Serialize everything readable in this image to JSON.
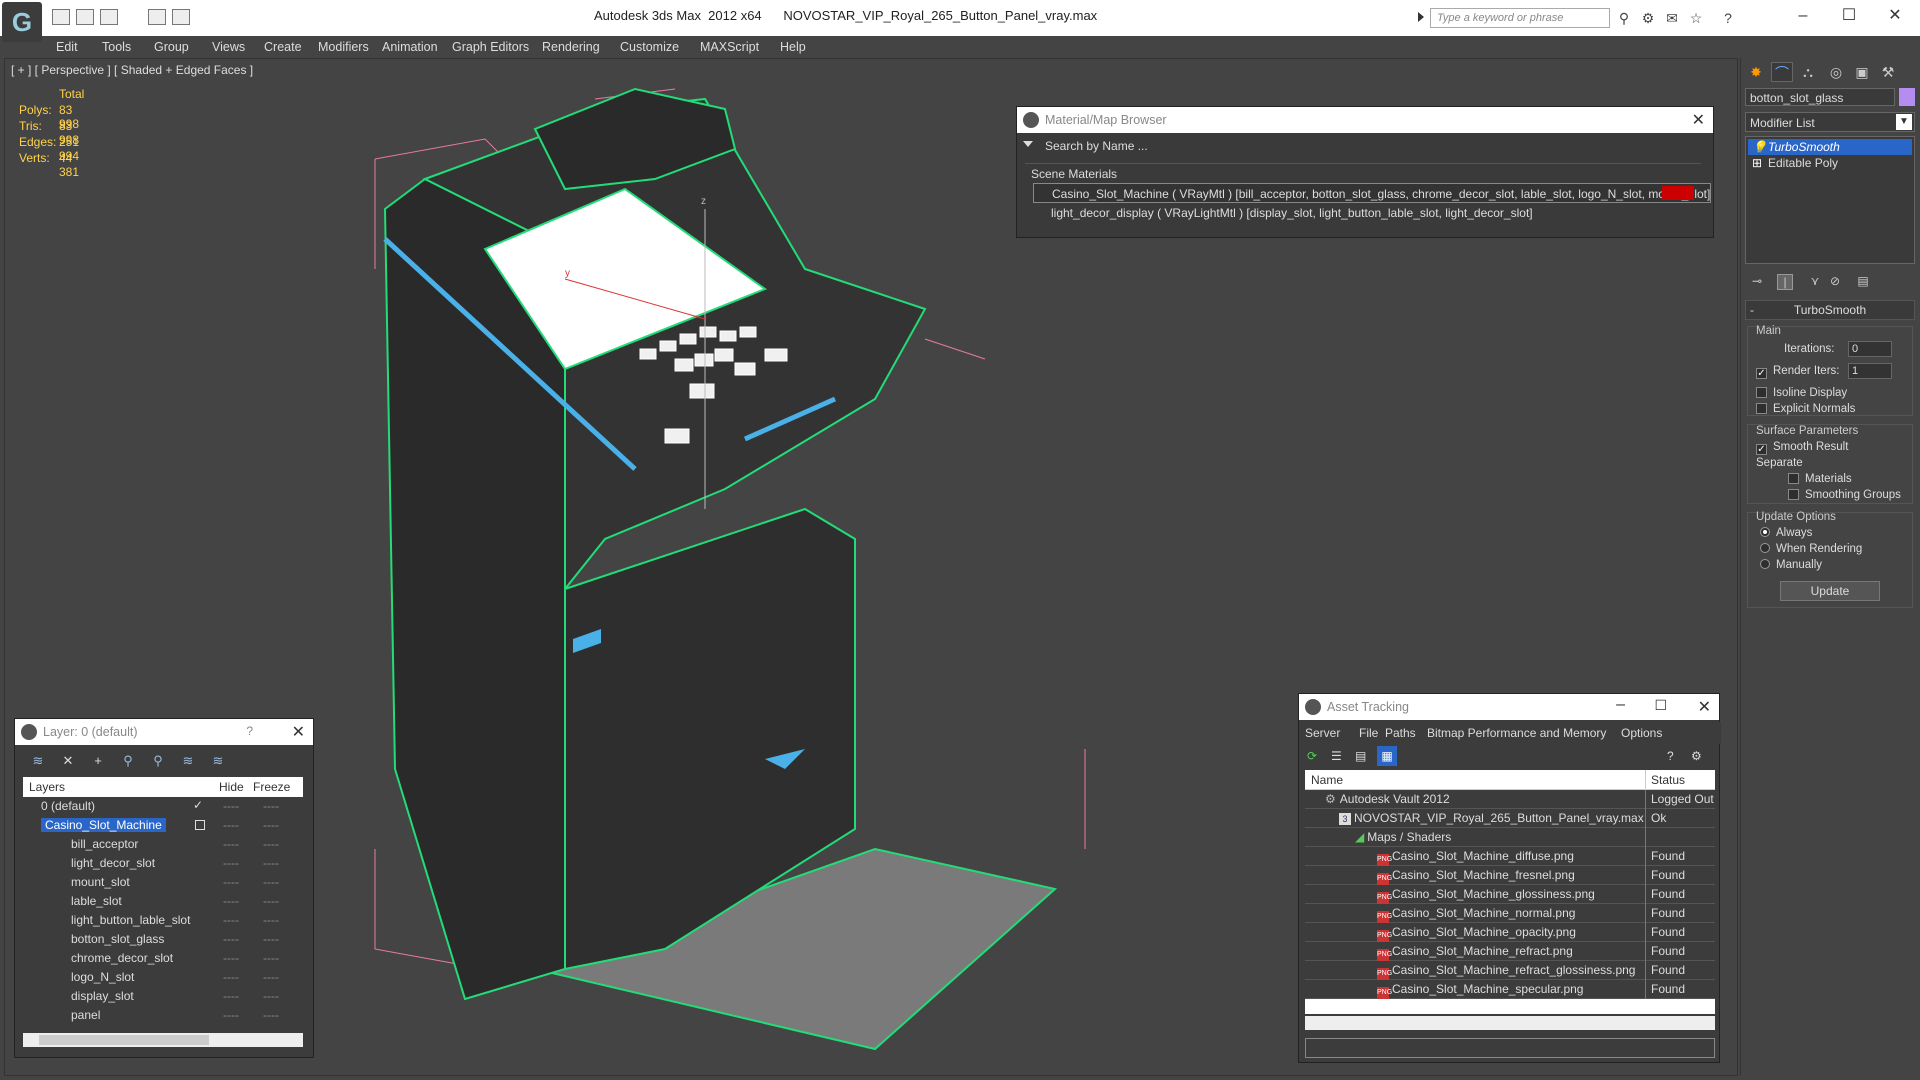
{
  "titlebar": {
    "title": "Autodesk 3ds Max  2012 x64      NOVOSTAR_VIP_Royal_265_Button_Panel_vray.max",
    "search_placeholder": "Type a keyword or phrase"
  },
  "menu": [
    "Edit",
    "Tools",
    "Group",
    "Views",
    "Create",
    "Modifiers",
    "Animation",
    "Graph Editors",
    "Rendering",
    "Customize",
    "MAXScript",
    "Help"
  ],
  "viewport": {
    "label": "[ + ] [ Perspective ] [ Shaded + Edged Faces ]",
    "stats": {
      "heading": "Total",
      "rows": [
        {
          "label": "Polys:",
          "value": "83 998"
        },
        {
          "label": "Tris:",
          "value": "83 998"
        },
        {
          "label": "Edges:",
          "value": "251 994"
        },
        {
          "label": "Verts:",
          "value": "44 381"
        }
      ]
    },
    "gizmo_labels": {
      "y": "y",
      "z": "z"
    }
  },
  "material_browser": {
    "title": "Material/Map Browser",
    "search_placeholder": "Search by Name ...",
    "section": "Scene Materials",
    "rows": [
      "Casino_Slot_Machine ( VRayMtl ) [bill_acceptor, botton_slot_glass, chrome_decor_slot, lable_slot, logo_N_slot, mount_slot]",
      "light_decor_display ( VRayLightMtl ) [display_slot, light_button_lable_slot, light_decor_slot]"
    ],
    "swatch_color": "#cc0000"
  },
  "layer_panel": {
    "title": "Layer: 0 (default)",
    "help": "?",
    "columns": {
      "layers": "Layers",
      "hide": "Hide",
      "freeze": "Freeze"
    },
    "rows": [
      {
        "name": "0 (default)",
        "hide": "----",
        "freeze": "----"
      },
      {
        "name": "Casino_Slot_Machine",
        "hide": "----",
        "freeze": "----"
      },
      {
        "name": "bill_acceptor",
        "hide": "----",
        "freeze": "----"
      },
      {
        "name": "light_decor_slot",
        "hide": "----",
        "freeze": "----"
      },
      {
        "name": "mount_slot",
        "hide": "----",
        "freeze": "----"
      },
      {
        "name": "lable_slot",
        "hide": "----",
        "freeze": "----"
      },
      {
        "name": "light_button_lable_slot",
        "hide": "----",
        "freeze": "----"
      },
      {
        "name": "botton_slot_glass",
        "hide": "----",
        "freeze": "----"
      },
      {
        "name": "chrome_decor_slot",
        "hide": "----",
        "freeze": "----"
      },
      {
        "name": "logo_N_slot",
        "hide": "----",
        "freeze": "----"
      },
      {
        "name": "display_slot",
        "hide": "----",
        "freeze": "----"
      },
      {
        "name": "panel",
        "hide": "----",
        "freeze": "----"
      }
    ]
  },
  "asset_tracking": {
    "title": "Asset Tracking",
    "menu": [
      "Server",
      "File",
      "Paths",
      "Bitmap Performance and Memory",
      "Options"
    ],
    "columns": {
      "name": "Name",
      "status": "Status"
    },
    "rows": [
      {
        "name": "Autodesk Vault 2012",
        "status": "Logged Out",
        "indent": 1
      },
      {
        "name": "NOVOSTAR_VIP_Royal_265_Button_Panel_vray.max",
        "status": "Ok",
        "indent": 2
      },
      {
        "name": "Maps / Shaders",
        "status": "",
        "indent": 3
      },
      {
        "name": "Casino_Slot_Machine_diffuse.png",
        "status": "Found",
        "indent": 4
      },
      {
        "name": "Casino_Slot_Machine_fresnel.png",
        "status": "Found",
        "indent": 4
      },
      {
        "name": "Casino_Slot_Machine_glossiness.png",
        "status": "Found",
        "indent": 4
      },
      {
        "name": "Casino_Slot_Machine_normal.png",
        "status": "Found",
        "indent": 4
      },
      {
        "name": "Casino_Slot_Machine_opacity.png",
        "status": "Found",
        "indent": 4
      },
      {
        "name": "Casino_Slot_Machine_refract.png",
        "status": "Found",
        "indent": 4
      },
      {
        "name": "Casino_Slot_Machine_refract_glossiness.png",
        "status": "Found",
        "indent": 4
      },
      {
        "name": "Casino_Slot_Machine_specular.png",
        "status": "Found",
        "indent": 4
      }
    ]
  },
  "command_panel": {
    "object_name": "botton_slot_glass",
    "object_color": "#b58cf0",
    "modifier_list": "Modifier List",
    "stack": [
      "TurboSmooth",
      "Editable Poly"
    ],
    "rollout_title": "TurboSmooth",
    "main_group": "Main",
    "iterations_label": "Iterations:",
    "iterations_value": "0",
    "render_iters_label": "Render Iters:",
    "render_iters_value": "1",
    "isoline": "Isoline Display",
    "explicit": "Explicit Normals",
    "surface_group": "Surface Parameters",
    "smooth_result": "Smooth Result",
    "separate": "Separate",
    "materials": "Materials",
    "smoothing_groups": "Smoothing Groups",
    "update_group": "Update Options",
    "always": "Always",
    "when_rendering": "When Rendering",
    "manually": "Manually",
    "update_button": "Update"
  }
}
